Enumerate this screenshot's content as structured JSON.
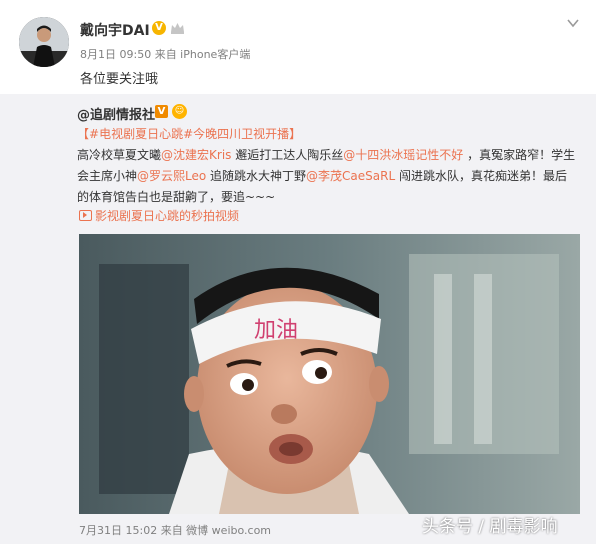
{
  "post": {
    "username": "戴向宇DAI",
    "verified_mark": "V",
    "meta": "8月1日 09:50 来自 iPhone客户端",
    "status_text": "各位要关注哦"
  },
  "repost": {
    "author": "@追剧情报社",
    "v_mark": "V",
    "line1_prefix": "【",
    "line1_tag": "#电视剧夏日心跳#",
    "line1_suffix": "今晚四川卫视开播】",
    "segments": [
      {
        "text": "高冷校草夏文曦",
        "link": false
      },
      {
        "text": "@沈建宏Kris",
        "link": true
      },
      {
        "text": " 邂逅打工达人陶乐丝",
        "link": false
      },
      {
        "text": "@十四洪冰瑶记性不好",
        "link": true
      },
      {
        "text": " ，真冤家路窄！学生会主席小神",
        "link": false
      },
      {
        "text": "@罗云熙Leo",
        "link": true
      },
      {
        "text": " 追随跳水大神丁野",
        "link": false
      },
      {
        "text": "@李茂CaeSaRL",
        "link": true
      },
      {
        "text": " 闯进跳水队，真花痴迷弟！最后的体育馆告白也是甜齁了，要追~~~",
        "link": false
      }
    ],
    "video_link": "影视剧夏日心跳的秒拍视频",
    "headband_text": "加油",
    "footer_meta": "7月31日 15:02 来自 微博 weibo.com"
  },
  "watermark": "头条号 / 剧毒影响",
  "colors": {
    "link": "#eb7350",
    "meta": "#808080",
    "repost_bg": "#f2f2f5"
  }
}
